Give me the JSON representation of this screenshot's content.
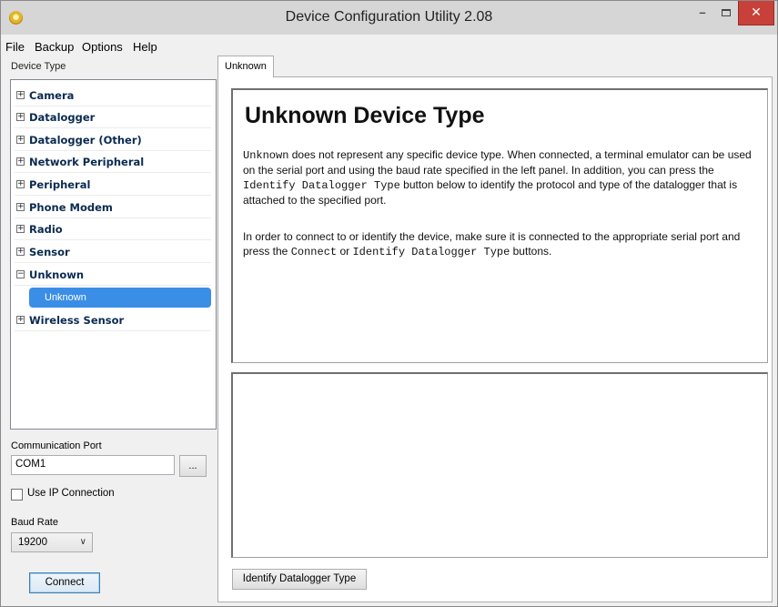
{
  "window": {
    "title": "Device Configuration Utility 2.08",
    "minimize_glyph": "–",
    "close_glyph": "✕"
  },
  "menu": [
    "File",
    "Backup",
    "Options",
    "Help"
  ],
  "sidebar": {
    "label": "Device Type",
    "categories": [
      {
        "label": "Camera",
        "expander": "⊞"
      },
      {
        "label": "Datalogger",
        "expander": "⊞"
      },
      {
        "label": "Datalogger (Other)",
        "expander": "⊞"
      },
      {
        "label": "Network Peripheral",
        "expander": "⊞"
      },
      {
        "label": "Peripheral",
        "expander": "⊞"
      },
      {
        "label": "Phone Modem",
        "expander": "⊞"
      },
      {
        "label": "Radio",
        "expander": "⊞"
      },
      {
        "label": "Sensor",
        "expander": "⊞"
      },
      {
        "label": "Unknown",
        "expander": "⊟"
      },
      {
        "label": "Wireless Sensor",
        "expander": "⊞"
      }
    ],
    "selected_item": "Unknown"
  },
  "comm": {
    "port_label": "Communication Port",
    "port_value": "COM1",
    "browse_label": "...",
    "ip_checkbox_label": "Use IP Connection",
    "ip_checked": false,
    "baud_label": "Baud Rate",
    "baud_value": "19200",
    "connect_label": "Connect"
  },
  "tab": {
    "label": "Unknown"
  },
  "description": {
    "title": "Unknown Device Type",
    "p1": {
      "code1": "Unknown",
      "text1": " does not represent any specific device type. When connected, a terminal emulator can be used on the serial port and using the baud rate specified in the left panel. In addition, you can press the ",
      "code2": "Identify Datalogger Type",
      "text2": " button below to identify the protocol and type of the datalogger that is attached to the specified port."
    },
    "p2": {
      "text1": "In order to connect to or identify the device, make sure it is connected to the appropriate serial port and press the ",
      "code1": "Connect",
      "text2": " or ",
      "code2": "Identify Datalogger Type",
      "text3": " buttons."
    }
  },
  "identify_button": "Identify Datalogger Type",
  "colors": {
    "selection": "#3a8ee6",
    "tree_text": "#0a2a50",
    "close_button": "#c7413a"
  }
}
